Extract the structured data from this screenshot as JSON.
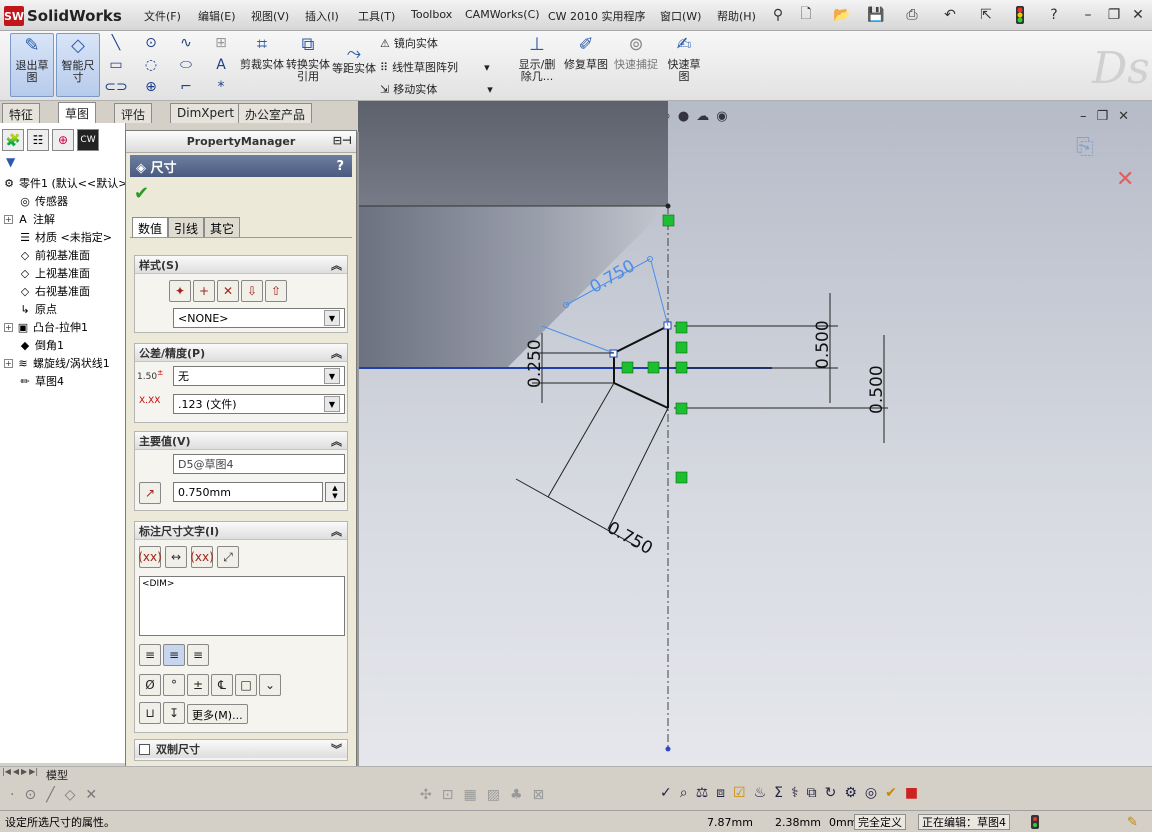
{
  "app": {
    "logo_badge": "SW",
    "logo_text": "SolidWorks"
  },
  "menu": [
    "文件(F)",
    "编辑(E)",
    "视图(V)",
    "插入(I)",
    "工具(T)",
    "Toolbox",
    "CAMWorks(C)",
    "CW 2010 实用程序",
    "窗口(W)",
    "帮助(H)"
  ],
  "commands": {
    "exit_sketch": "退出草图",
    "smart_dim": "智能尺寸",
    "trim": "剪裁实体",
    "convert": "转换实体引用",
    "offset": "等距实体",
    "mirror": "镜向实体",
    "linear_pattern": "线性草图阵列",
    "move": "移动实体",
    "show_delete": "显示/删除几...",
    "repair": "修复草图",
    "quick_snap": "快速捕捉",
    "rapid_sketch": "快速草图"
  },
  "tabs": [
    "特征",
    "草图",
    "评估",
    "DimXpert",
    "办公室产品"
  ],
  "active_tab": "草图",
  "tree": {
    "root": "零件1 (默认<<默认>",
    "items": [
      "传感器",
      "注解",
      "材质 <未指定>",
      "前视基准面",
      "上视基准面",
      "右视基准面",
      "原点",
      "凸台-拉伸1",
      "倒角1",
      "螺旋线/涡状线1",
      "草图4"
    ]
  },
  "pm": {
    "header": "PropertyManager",
    "title": "尺寸",
    "help": "?",
    "tabs": [
      "数值",
      "引线",
      "其它"
    ],
    "style_title": "样式(S)",
    "style_value": "<NONE>",
    "tol_title": "公差/精度(P)",
    "tol_value": "无",
    "precision_value": ".123 (文件)",
    "primary_title": "主要值(V)",
    "primary_name": "D5@草图4",
    "primary_value": "0.750mm",
    "dimtext_title": "标注尺寸文字(I)",
    "dimtext_value": "<DIM>",
    "more": "更多(M)...",
    "dual_title": "双制尺寸"
  },
  "bottom_tabs": [
    "模型"
  ],
  "status": {
    "hint": "设定所选尺寸的属性。",
    "x": "7.87mm",
    "y": "2.38mm",
    "z": "0mm",
    "state": "完全定义",
    "editing": "正在编辑：草图4"
  },
  "dims": {
    "d1": "0.750",
    "d2": "0.250",
    "d3": "0.500",
    "d4": "0.500",
    "d5": "0.750"
  },
  "colors": {
    "accent": "#4a5a80",
    "dim_blue": "#4d8fe8",
    "constraint_green": "#1bbf2f"
  }
}
